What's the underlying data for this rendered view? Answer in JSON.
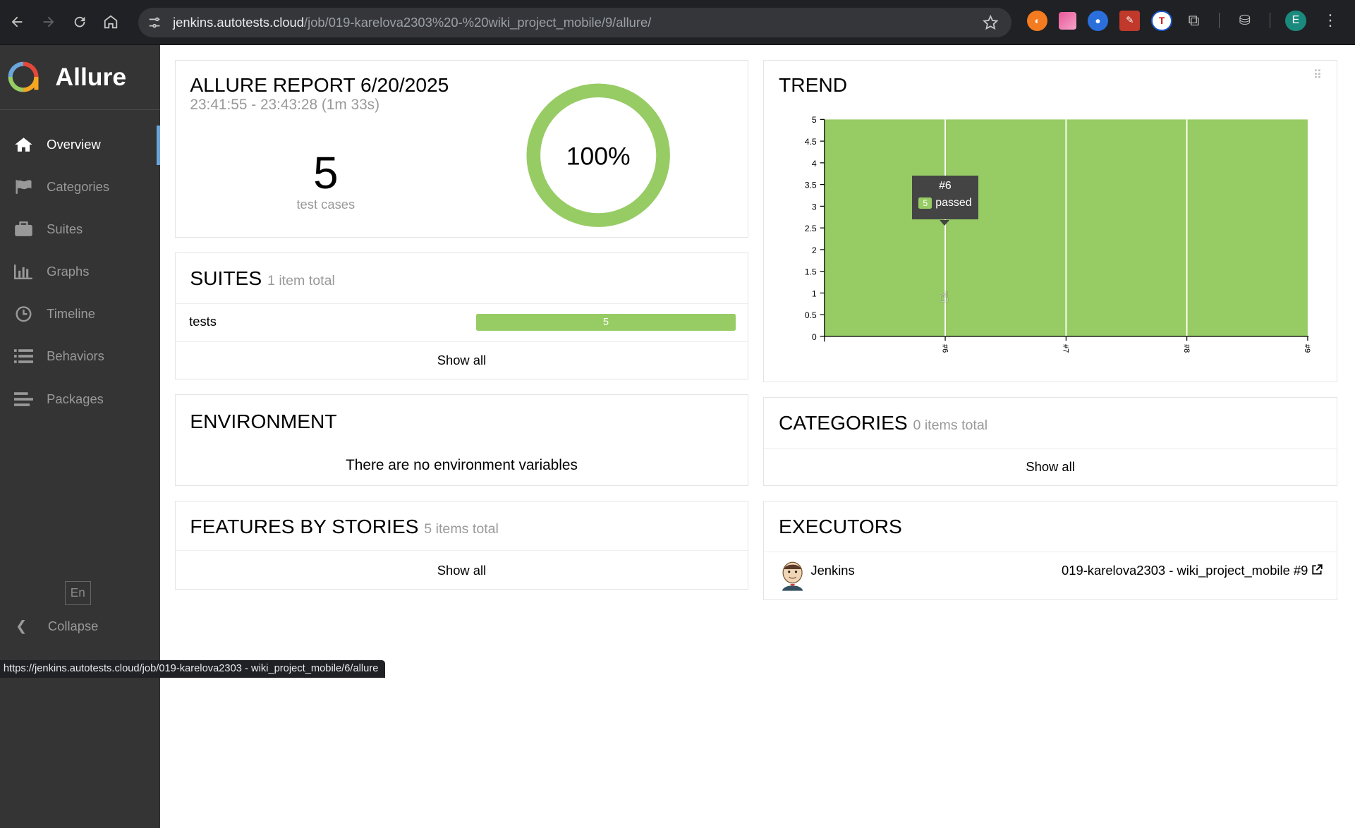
{
  "browser": {
    "url_host": "jenkins.autotests.cloud",
    "url_path": "/job/019-karelova2303%20-%20wiki_project_mobile/9/allure/",
    "profile_initial": "E",
    "status_url": "https://jenkins.autotests.cloud/job/019-karelova2303 - wiki_project_mobile/6/allure"
  },
  "sidebar": {
    "brand": "Allure",
    "items": [
      {
        "label": "Overview",
        "icon": "home-icon"
      },
      {
        "label": "Categories",
        "icon": "flag-icon"
      },
      {
        "label": "Suites",
        "icon": "briefcase-icon"
      },
      {
        "label": "Graphs",
        "icon": "bar-chart-icon"
      },
      {
        "label": "Timeline",
        "icon": "clock-icon"
      },
      {
        "label": "Behaviors",
        "icon": "list-icon"
      },
      {
        "label": "Packages",
        "icon": "align-left-icon"
      }
    ],
    "language": "En",
    "collapse_label": "Collapse"
  },
  "summary": {
    "title": "ALLURE REPORT 6/20/2025",
    "time_range": "23:41:55 - 23:43:28 (1m 33s)",
    "test_count": "5",
    "test_count_label": "test cases",
    "percent": "100%",
    "pass_fraction": 1.0
  },
  "suites": {
    "title": "SUITES",
    "subtitle": "1 item total",
    "rows": [
      {
        "name": "tests",
        "passed": "5"
      }
    ],
    "show_all": "Show all"
  },
  "environment": {
    "title": "ENVIRONMENT",
    "empty_text": "There are no environment variables"
  },
  "features": {
    "title": "FEATURES BY STORIES",
    "subtitle": "5 items total",
    "show_all": "Show all"
  },
  "trend": {
    "title": "TREND",
    "tooltip": {
      "build": "#6",
      "count": "5",
      "status": "passed"
    }
  },
  "chart_data": {
    "type": "area",
    "title": "TREND",
    "x": [
      "#6",
      "#7",
      "#8",
      "#9"
    ],
    "series": [
      {
        "name": "passed",
        "values": [
          5,
          5,
          5,
          5
        ]
      }
    ],
    "ylim": [
      0,
      5
    ],
    "yticks": [
      "0",
      "0.5",
      "1",
      "1.5",
      "2",
      "2.5",
      "3",
      "3.5",
      "4",
      "4.5",
      "5"
    ],
    "color": "#97cc64"
  },
  "categories": {
    "title": "CATEGORIES",
    "subtitle": "0 items total",
    "show_all": "Show all"
  },
  "executors": {
    "title": "EXECUTORS",
    "name": "Jenkins",
    "build": "019-karelova2303 - wiki_project_mobile #9"
  },
  "colors": {
    "passed": "#97cc64",
    "sidebar_bg": "#343434",
    "active_marker": "#6aa6db"
  }
}
